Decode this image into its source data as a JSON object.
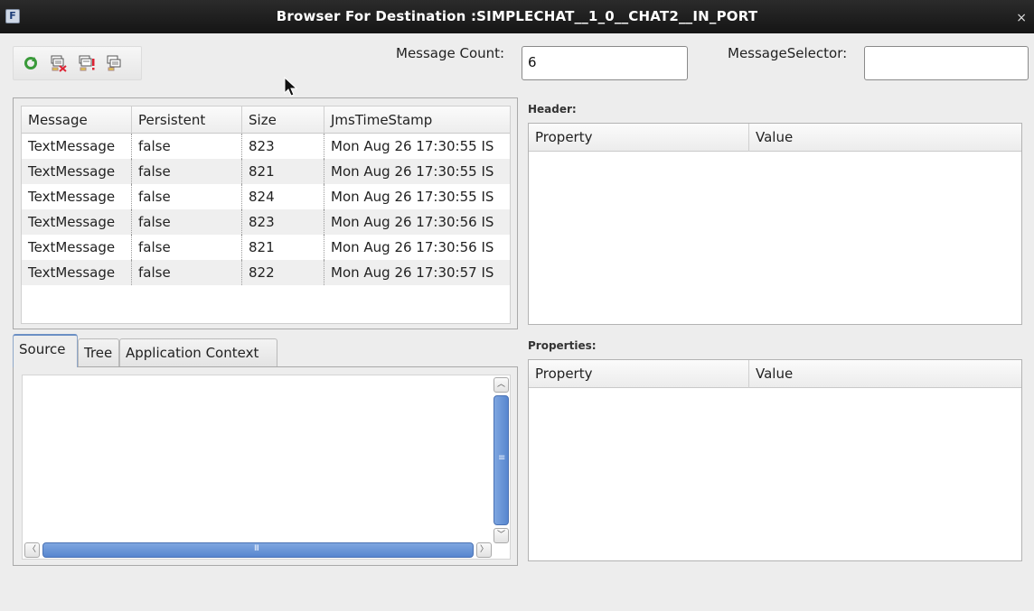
{
  "window": {
    "icon_letter": "F",
    "title": "Browser For Destination :SIMPLECHAT__1_0__CHAT2__IN_PORT",
    "close_glyph": "×"
  },
  "toolbar": {
    "buttons": [
      {
        "name": "refresh-icon",
        "color": "#3a9a3a"
      },
      {
        "name": "delete-messages-icon",
        "color": "#c44"
      },
      {
        "name": "message-alert-icon",
        "color": "#c44"
      },
      {
        "name": "copy-messages-icon",
        "color": "#555"
      }
    ]
  },
  "message_count": {
    "label": "Message Count:",
    "value": "6"
  },
  "message_selector": {
    "label": "MessageSelector:",
    "value": ""
  },
  "messages_table": {
    "columns": [
      "Message",
      "Persistent",
      "Size",
      "JmsTimeStamp"
    ],
    "rows": [
      [
        "TextMessage",
        "false",
        "823",
        "Mon Aug 26 17:30:55 IS"
      ],
      [
        "TextMessage",
        "false",
        "821",
        "Mon Aug 26 17:30:55 IS"
      ],
      [
        "TextMessage",
        "false",
        "824",
        "Mon Aug 26 17:30:55 IS"
      ],
      [
        "TextMessage",
        "false",
        "823",
        "Mon Aug 26 17:30:56 IS"
      ],
      [
        "TextMessage",
        "false",
        "821",
        "Mon Aug 26 17:30:56 IS"
      ],
      [
        "TextMessage",
        "false",
        "822",
        "Mon Aug 26 17:30:57 IS"
      ]
    ]
  },
  "tabs": [
    {
      "label": "Source",
      "active": true
    },
    {
      "label": "Tree",
      "active": false
    },
    {
      "label": "Application Context",
      "active": false
    }
  ],
  "scrollbar": {
    "v_grip": "≡",
    "h_grip": "III",
    "up": "︿",
    "down": "﹀",
    "left": "〈",
    "right": "〉"
  },
  "header_section": {
    "label": "Header:",
    "columns": [
      "Property",
      "Value"
    ]
  },
  "properties_section": {
    "label": "Properties:",
    "columns": [
      "Property",
      "Value"
    ]
  }
}
